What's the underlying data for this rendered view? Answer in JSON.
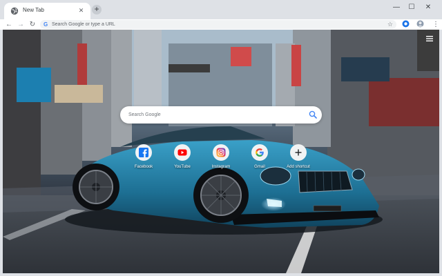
{
  "browser": {
    "tab": {
      "title": "New Tab",
      "close_glyph": "✕"
    },
    "new_tab_glyph": "+",
    "window_controls": {
      "minimize": "—",
      "maximize": "☐",
      "close": "✕"
    },
    "nav": {
      "back": "←",
      "forward": "→",
      "reload": "↻"
    },
    "omnibox": {
      "g_glyph": "G",
      "placeholder": "Search Google or type a URL"
    },
    "star_glyph": "☆",
    "menu_glyph": "⋮"
  },
  "page": {
    "search": {
      "placeholder": "Search Google"
    },
    "shortcuts": [
      {
        "label": "Facebook",
        "icon": "facebook-icon",
        "color": "#1877f2"
      },
      {
        "label": "YouTube",
        "icon": "youtube-icon",
        "color": "#ff0000"
      },
      {
        "label": "Instagram",
        "icon": "instagram-icon",
        "color": "#c13584"
      },
      {
        "label": "Gmail",
        "icon": "google-icon",
        "color": "#4285f4"
      },
      {
        "label": "Add shortcut",
        "icon": "plus-icon",
        "color": "#202124"
      }
    ],
    "settings_glyph": "☰"
  }
}
